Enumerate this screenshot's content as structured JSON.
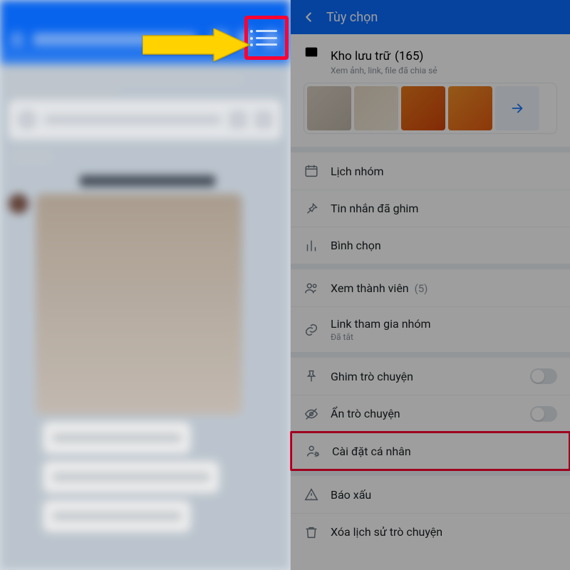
{
  "right": {
    "header_title": "Tùy chọn",
    "archive": {
      "title": "Kho lưu trữ",
      "count": "(165)",
      "subtitle": "Xem ảnh, link, file đã chia sẻ"
    },
    "rows": {
      "calendar": "Lịch nhóm",
      "pinned_msgs": "Tin nhắn đã ghim",
      "polls": "Bình chọn",
      "members": "Xem thành viên",
      "members_count": "(5)",
      "join_link": "Link tham gia nhóm",
      "join_link_sub": "Đã tắt",
      "pin_chat": "Ghim trò chuyện",
      "hide_chat": "Ẩn trò chuyện",
      "personal_settings": "Cài đặt cá nhân",
      "report": "Báo xấu",
      "delete_history": "Xóa lịch sử trò chuyện"
    }
  },
  "icons": {
    "back": "back-arrow",
    "list": "list-icon",
    "media": "image-icon",
    "calendar": "calendar-icon",
    "pin": "pin-icon",
    "poll": "poll-icon",
    "members": "members-icon",
    "link": "link-icon",
    "pin_chat": "pushpin-icon",
    "hide": "eye-off-icon",
    "settings": "user-gear-icon",
    "report": "warning-icon",
    "trash": "trash-icon",
    "more_arrow": "arrow-right-icon"
  },
  "annotation": {
    "arrow_color": "#ffd200",
    "highlight_color": "#ff0033"
  }
}
